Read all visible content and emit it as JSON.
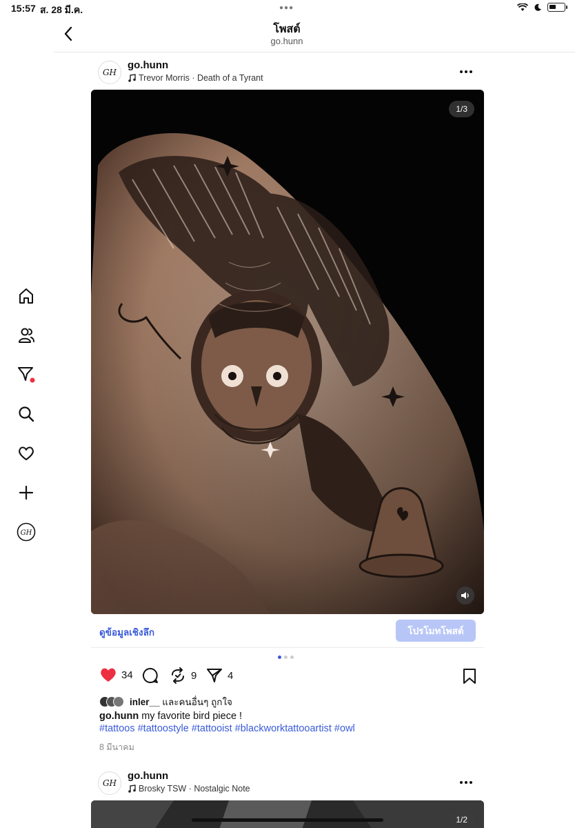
{
  "status": {
    "time": "15:57",
    "date": "ส. 28 มี.ค."
  },
  "header": {
    "title": "โพสต์",
    "subtitle": "go.hunn"
  },
  "posts": [
    {
      "user": "go.hunn",
      "avatar": "GH",
      "music": "Trevor Morris · Death of a Tyrant",
      "counter": "1/3",
      "insights": "ดูข้อมูลเชิงลึก",
      "promote": "โปรโมทโพสต์",
      "pager": {
        "current": 1,
        "total": 3
      },
      "actions": {
        "likes": "34",
        "reposts": "9",
        "shares": "4"
      },
      "liked_by_user": "inler__",
      "liked_by_rest": "และคนอื่นๆ ถูกใจ",
      "caption_text": "my favorite bird piece !",
      "hashtags": "#tattoos #tattoostyle #tattooist #blackworktattooartist #owl",
      "date": "8 มีนาคม"
    },
    {
      "user": "go.hunn",
      "avatar": "GH",
      "music": "Brosky TSW · Nostalgic Note",
      "counter": "1/2"
    }
  ],
  "icons": {
    "back": "chevron-left-icon",
    "nav": [
      "home-icon",
      "users-icon",
      "filter-icon",
      "search-icon",
      "heart-icon",
      "plus-icon",
      "profile-avatar-icon"
    ],
    "actions": [
      "heart-icon",
      "comment-icon",
      "repost-icon",
      "share-icon",
      "bookmark-icon"
    ]
  },
  "colors": {
    "accent": "#3a5bd9",
    "like": "#ed2f42",
    "promote": "#b8c6f7",
    "notification_dot": "#ed2f42"
  }
}
